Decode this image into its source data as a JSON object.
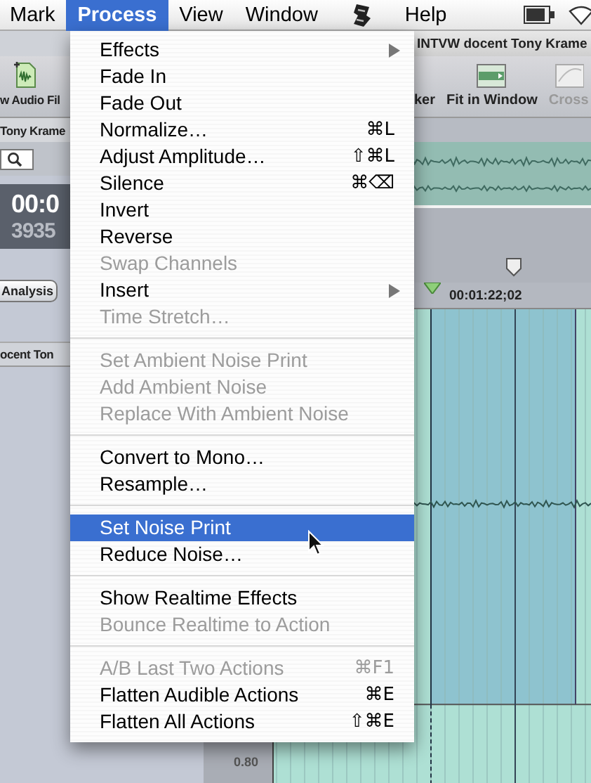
{
  "menu_bar": {
    "items": [
      {
        "kind": "menu",
        "label": "Mark",
        "selected": false
      },
      {
        "kind": "menu",
        "label": "Process",
        "selected": true
      },
      {
        "kind": "menu",
        "label": "View",
        "selected": false
      },
      {
        "kind": "menu",
        "label": "Window",
        "selected": false
      },
      {
        "kind": "script",
        "selected": false
      },
      {
        "kind": "menu",
        "label": "Help",
        "selected": false
      }
    ]
  },
  "process_menu": {
    "items": [
      {
        "kind": "item",
        "label": "Effects",
        "submenu": true,
        "disabled": false,
        "selected": false
      },
      {
        "kind": "item",
        "label": "Fade In",
        "disabled": false,
        "selected": false
      },
      {
        "kind": "item",
        "label": "Fade Out",
        "disabled": false,
        "selected": false
      },
      {
        "kind": "item",
        "label": "Normalize…",
        "shortcut": "⌘L",
        "disabled": false,
        "selected": false
      },
      {
        "kind": "item",
        "label": "Adjust Amplitude…",
        "shortcut": "⇧⌘L",
        "disabled": false,
        "selected": false
      },
      {
        "kind": "item",
        "label": "Silence",
        "shortcut": "⌘⌫",
        "disabled": false,
        "selected": false
      },
      {
        "kind": "item",
        "label": "Invert",
        "disabled": false,
        "selected": false
      },
      {
        "kind": "item",
        "label": "Reverse",
        "disabled": false,
        "selected": false
      },
      {
        "kind": "item",
        "label": "Swap Channels",
        "disabled": true,
        "selected": false
      },
      {
        "kind": "item",
        "label": "Insert",
        "submenu": true,
        "disabled": false,
        "selected": false
      },
      {
        "kind": "item",
        "label": "Time Stretch…",
        "disabled": true,
        "selected": false
      },
      {
        "kind": "separator"
      },
      {
        "kind": "item",
        "label": "Set Ambient Noise Print",
        "disabled": true,
        "selected": false
      },
      {
        "kind": "item",
        "label": "Add Ambient Noise",
        "disabled": true,
        "selected": false
      },
      {
        "kind": "item",
        "label": "Replace With Ambient Noise",
        "disabled": true,
        "selected": false
      },
      {
        "kind": "separator"
      },
      {
        "kind": "item",
        "label": "Convert to Mono…",
        "disabled": false,
        "selected": false
      },
      {
        "kind": "item",
        "label": "Resample…",
        "disabled": false,
        "selected": false
      },
      {
        "kind": "separator"
      },
      {
        "kind": "item",
        "label": "Set Noise Print",
        "disabled": false,
        "selected": true
      },
      {
        "kind": "item",
        "label": "Reduce Noise…",
        "disabled": false,
        "selected": false
      },
      {
        "kind": "separator"
      },
      {
        "kind": "item",
        "label": "Show Realtime Effects",
        "disabled": false,
        "selected": false
      },
      {
        "kind": "item",
        "label": "Bounce Realtime to Action",
        "disabled": true,
        "selected": false
      },
      {
        "kind": "separator"
      },
      {
        "kind": "item",
        "label": "A/B Last Two Actions",
        "shortcut": "⌘F1",
        "disabled": true,
        "selected": false
      },
      {
        "kind": "item",
        "label": "Flatten Audible Actions",
        "shortcut": "⌘E",
        "disabled": false,
        "selected": false
      },
      {
        "kind": "item",
        "label": "Flatten All Actions",
        "shortcut": "⇧⌘E",
        "disabled": false,
        "selected": false
      }
    ]
  },
  "app_window": {
    "title": "INTVW docent Tony Krame",
    "toolbar": [
      {
        "label": "w Audio Fil"
      },
      {
        "label": "ker"
      },
      {
        "label": "Fit in Window"
      },
      {
        "label": "Cross",
        "disabled": true
      }
    ],
    "file_label": "Tony Krame",
    "timecode": "00:0",
    "samples": "3935",
    "analysis_button": "Analysis",
    "track_name": "ocent Ton",
    "ruler_time": "00:01:22;02",
    "level_tick": "0.80"
  }
}
